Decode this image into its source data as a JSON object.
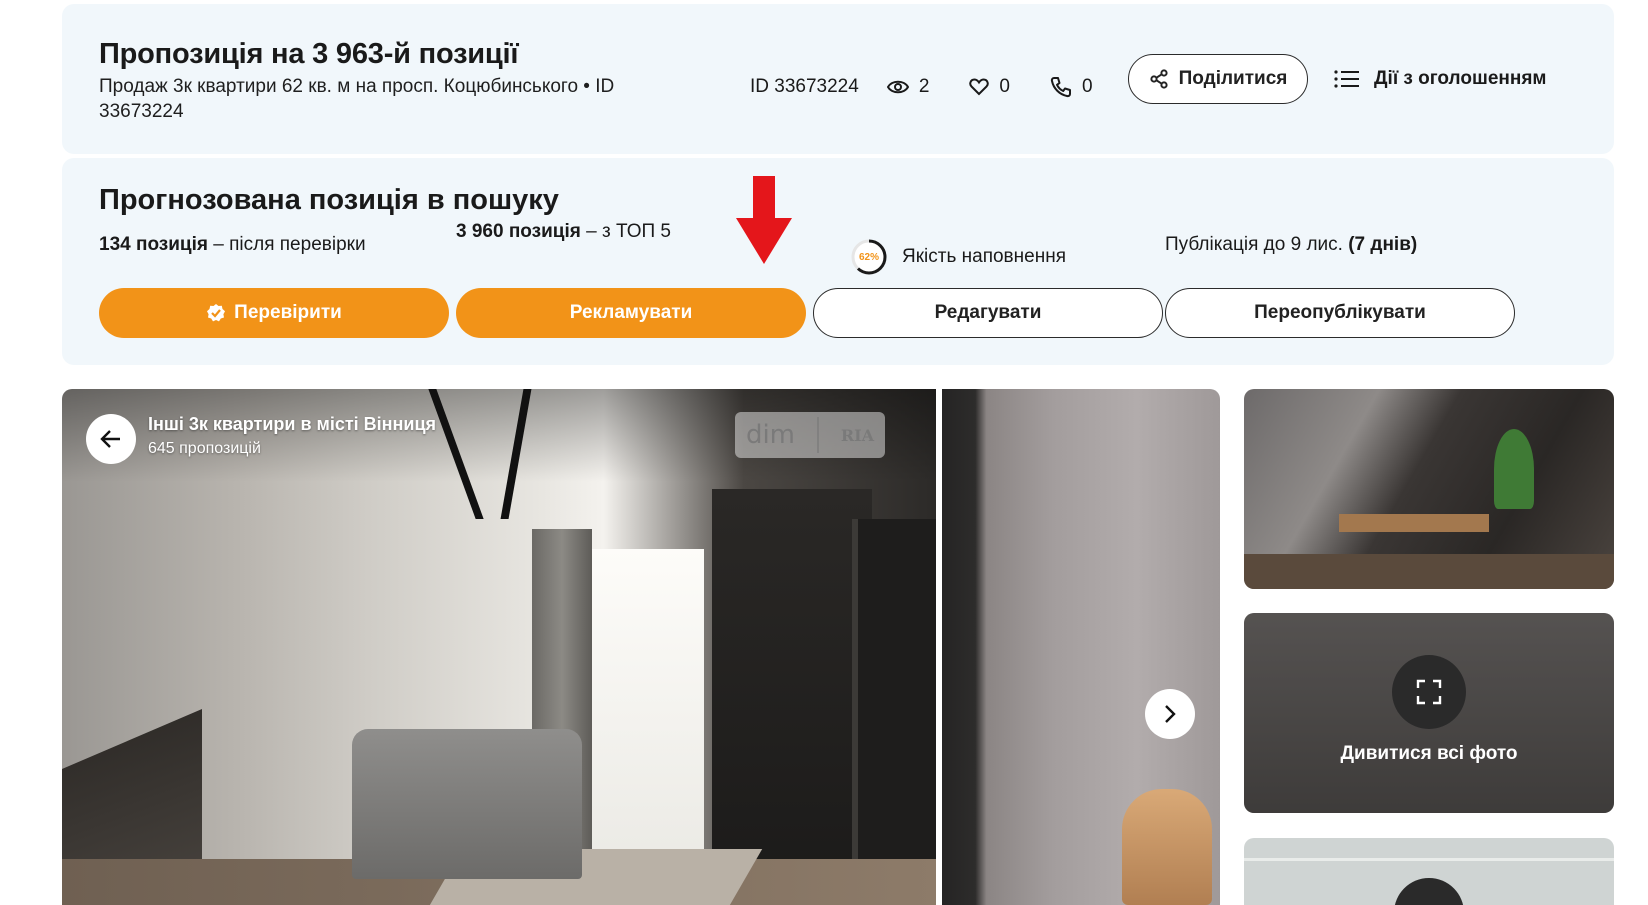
{
  "header": {
    "title": "Пропозиція на 3 963-й позиції",
    "subtitle": "Продаж 3к квартири 62 кв. м на просп. Коцюбинського • ID 33673224",
    "id_label": "ID 33673224",
    "views": "2",
    "favorites": "0",
    "calls": "0",
    "share_label": "Поділитися",
    "actions_label": "Дії з оголошенням"
  },
  "forecast": {
    "title": "Прогнозована позиція в пошуку",
    "check_position": "134 позиція",
    "check_note": " – після перевірки",
    "top_position": "3 960 позиція",
    "top_note": " – з ТОП 5",
    "quality_percent": "62%",
    "quality_value": 0.62,
    "quality_label": "Якість наповнення",
    "publication_label": "Публікація до 9 лис. ",
    "publication_days": "(7 днів)",
    "buttons": {
      "check": "Перевірити",
      "advertise": "Рекламувати",
      "edit": "Редагувати",
      "republish": "Переопублікувати"
    }
  },
  "gallery": {
    "overlay_title": "Інші 3к квартири в місті Вінниця",
    "overlay_sub": "645 пропозицій",
    "watermark_left": "dim",
    "watermark_right": "RIA",
    "all_photos_label": "Дивитися всі фото"
  },
  "colors": {
    "accent": "#f29318",
    "arrow": "#e4161b",
    "card_bg": "#f1f7fb"
  },
  "icons": [
    "eye-icon",
    "heart-icon",
    "phone-icon",
    "share-icon",
    "list-icon",
    "verified-icon",
    "arrow-left-icon",
    "chevron-right-icon",
    "fullscreen-icon",
    "down-arrow-annotation"
  ]
}
